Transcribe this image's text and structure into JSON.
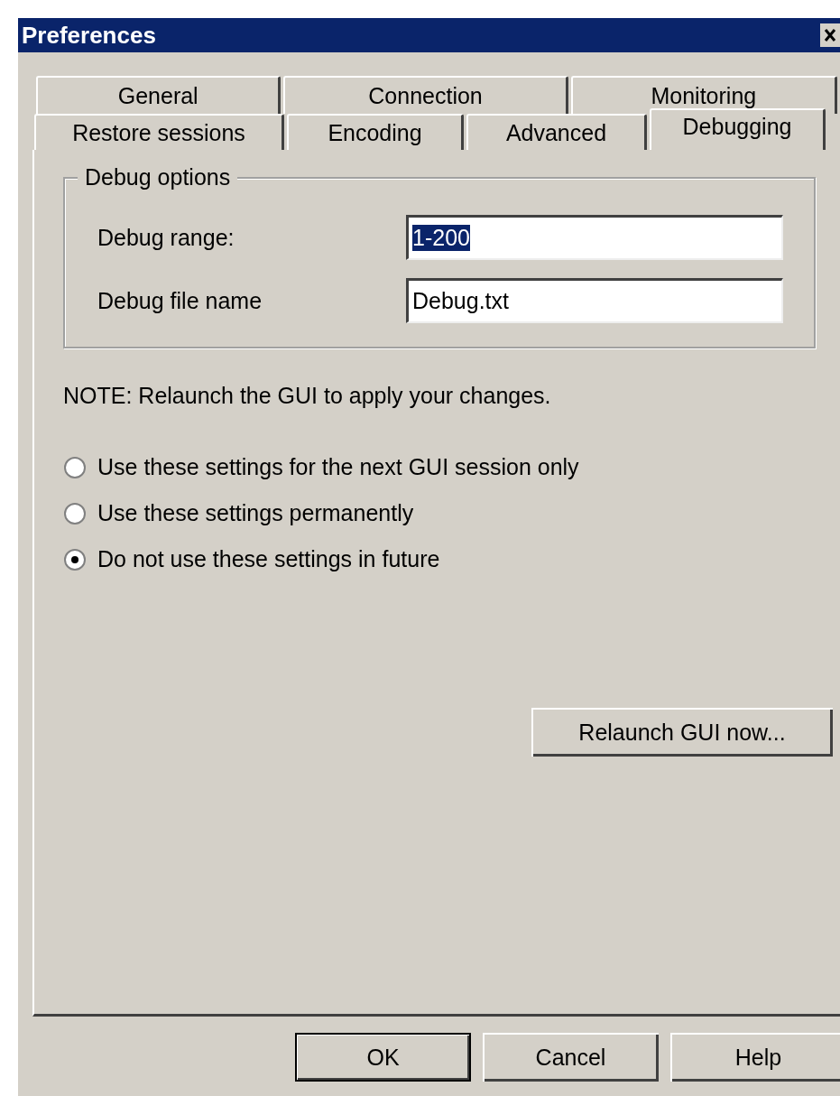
{
  "window": {
    "title": "Preferences"
  },
  "tab_rows": [
    {
      "tabs": [
        {
          "label": "General",
          "selected": false
        },
        {
          "label": "Connection",
          "selected": false
        },
        {
          "label": "Monitoring",
          "selected": false
        }
      ]
    },
    {
      "tabs": [
        {
          "label": "Restore sessions",
          "selected": false
        },
        {
          "label": "Encoding",
          "selected": false
        },
        {
          "label": "Advanced",
          "selected": false
        },
        {
          "label": "Debugging",
          "selected": true
        }
      ]
    }
  ],
  "debug_options": {
    "title": "Debug options",
    "fields": [
      {
        "label": "Debug range:",
        "value": "1-200",
        "text_selected": true
      },
      {
        "label": "Debug file name",
        "value": "Debug.txt",
        "text_selected": false
      }
    ]
  },
  "note": "NOTE: Relaunch the GUI to apply your changes.",
  "radio_options": [
    {
      "label": "Use these settings for the next GUI session only",
      "selected": false
    },
    {
      "label": "Use these settings permanently",
      "selected": false
    },
    {
      "label": "Do not use these settings in future",
      "selected": true
    }
  ],
  "relaunch_button": "Relaunch GUI now...",
  "buttons": [
    {
      "label": "OK",
      "default": true
    },
    {
      "label": "Cancel",
      "default": false
    },
    {
      "label": "Help",
      "default": false
    }
  ]
}
